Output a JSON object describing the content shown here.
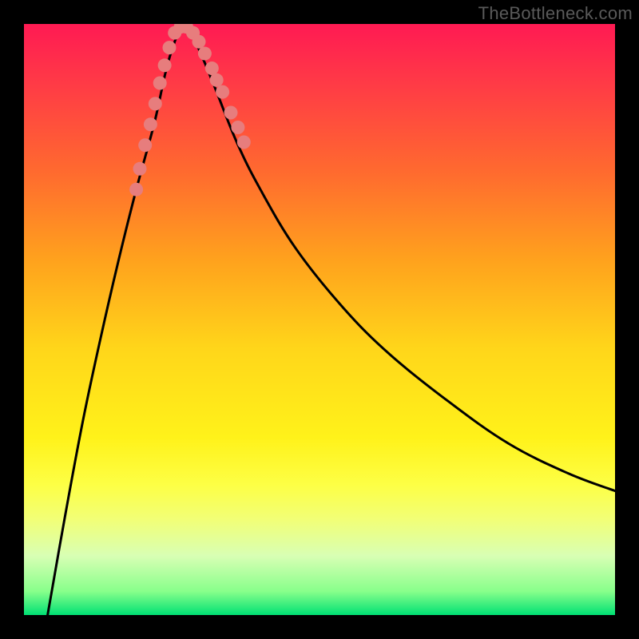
{
  "watermark": "TheBottleneck.com",
  "chart_data": {
    "type": "line",
    "title": "",
    "xlabel": "",
    "ylabel": "",
    "x_range_pct": [
      0,
      100
    ],
    "y_range_pct": [
      0,
      100
    ],
    "series": [
      {
        "name": "bottleneck-curve",
        "x_pct": [
          4,
          7,
          10,
          13,
          16,
          19,
          22,
          24,
          25.5,
          27,
          29,
          32,
          36,
          40,
          46,
          54,
          62,
          72,
          82,
          92,
          100
        ],
        "y_pct": [
          0,
          17,
          33,
          47,
          60,
          72,
          83,
          92,
          97,
          100,
          97,
          90,
          80,
          72,
          62,
          52,
          44,
          36,
          29,
          24,
          21
        ]
      },
      {
        "name": "marker-dots",
        "x_pct": [
          19.0,
          19.6,
          20.5,
          21.4,
          22.2,
          23.0,
          23.8,
          24.6,
          25.5,
          26.5,
          27.5,
          28.6,
          29.6,
          30.6,
          31.8,
          32.6,
          33.6,
          35.0,
          36.2,
          37.2
        ],
        "y_pct": [
          72.0,
          75.5,
          79.5,
          83.0,
          86.5,
          90.0,
          93.0,
          96.0,
          98.5,
          99.5,
          99.5,
          98.5,
          97.0,
          95.0,
          92.5,
          90.5,
          88.5,
          85.0,
          82.5,
          80.0
        ]
      }
    ],
    "colors": {
      "curve": "#000000",
      "markers": "#e77d7d",
      "gradient_top": "#ff1a53",
      "gradient_mid": "#ffd61a",
      "gradient_bottom": "#00e074"
    }
  }
}
